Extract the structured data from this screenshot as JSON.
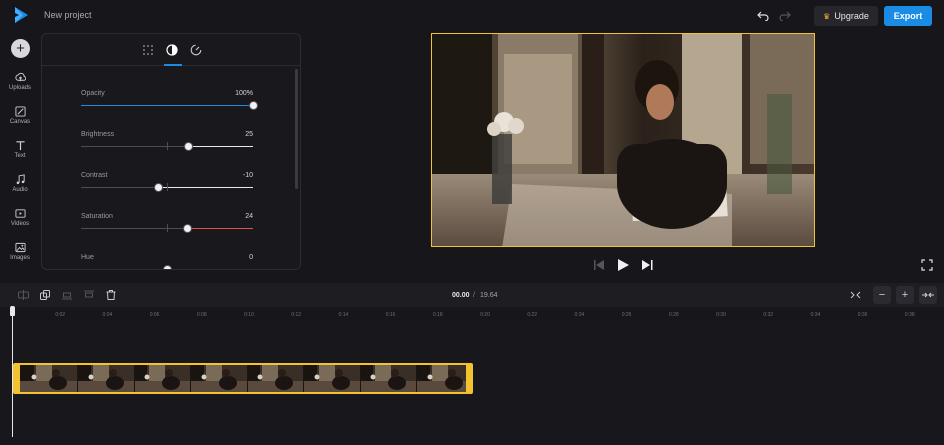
{
  "header": {
    "project_title": "New project",
    "upgrade_label": "Upgrade",
    "export_label": "Export"
  },
  "colors": {
    "accent": "#1b8ce6",
    "clip_border": "#f2c230",
    "saturation": "#d9534f"
  },
  "sidebar": {
    "items": [
      {
        "label": "Uploads",
        "icon": "cloud-upload-icon"
      },
      {
        "label": "Canvas",
        "icon": "canvas-icon"
      },
      {
        "label": "Text",
        "icon": "text-icon"
      },
      {
        "label": "Audio",
        "icon": "music-note-icon"
      },
      {
        "label": "Videos",
        "icon": "video-icon"
      },
      {
        "label": "Images",
        "icon": "image-icon"
      }
    ]
  },
  "panel": {
    "tabs": [
      {
        "icon": "grid-icon"
      },
      {
        "icon": "contrast-icon",
        "active": true
      },
      {
        "icon": "speed-icon"
      }
    ],
    "sliders": [
      {
        "name": "Opacity",
        "value": "100",
        "unit": "%",
        "fraction": 1.0,
        "bipolar": false
      },
      {
        "name": "Brightness",
        "value": "25",
        "unit": "",
        "fraction": 0.625,
        "bipolar": true
      },
      {
        "name": "Contrast",
        "value": "-10",
        "unit": "",
        "fraction": 0.45,
        "bipolar": true
      },
      {
        "name": "Saturation",
        "value": "24",
        "unit": "",
        "fraction": 0.62,
        "bipolar": true
      },
      {
        "name": "Hue",
        "value": "0",
        "unit": "",
        "fraction": 0.5,
        "bipolar": true
      }
    ]
  },
  "playback": {
    "current_time": "00.00",
    "separator": "/",
    "total_time": "19.64"
  },
  "ruler": {
    "labels": [
      "0",
      "0:02",
      "0:04",
      "0:06",
      "0:08",
      "0:10",
      "0:12",
      "0:14",
      "0:16",
      "0:18",
      "0:20",
      "0:22",
      "0:24",
      "0:26",
      "0:28",
      "0:30",
      "0:32",
      "0:34",
      "0:36",
      "0:38"
    ]
  },
  "timeline": {
    "clip_frames": 8
  }
}
